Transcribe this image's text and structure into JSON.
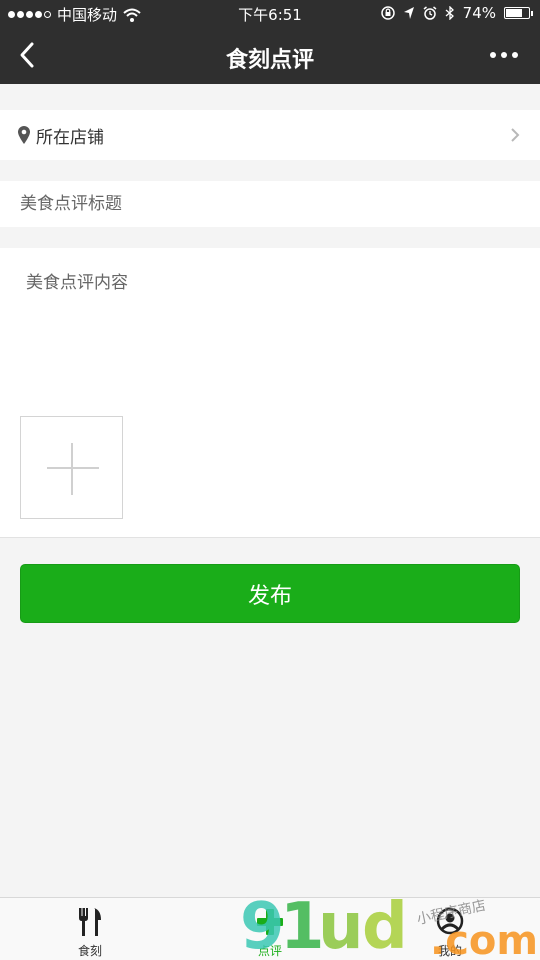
{
  "status_bar": {
    "carrier": "中国移动",
    "time": "下午6:51",
    "battery": "74%",
    "battery_level": 0.74
  },
  "nav": {
    "title": "食刻点评"
  },
  "form": {
    "shop_label": "所在店铺",
    "title_placeholder": "美食点评标题",
    "content_placeholder": "美食点评内容",
    "publish_label": "发布"
  },
  "tabs": [
    {
      "label": "食刻",
      "icon": "fork-knife-icon"
    },
    {
      "label": "点评",
      "icon": "plus-icon"
    },
    {
      "label": "我的",
      "icon": "user-icon"
    }
  ],
  "colors": {
    "accent": "#1aad19",
    "navbar": "#2f2f2f",
    "background": "#f4f4f4"
  }
}
